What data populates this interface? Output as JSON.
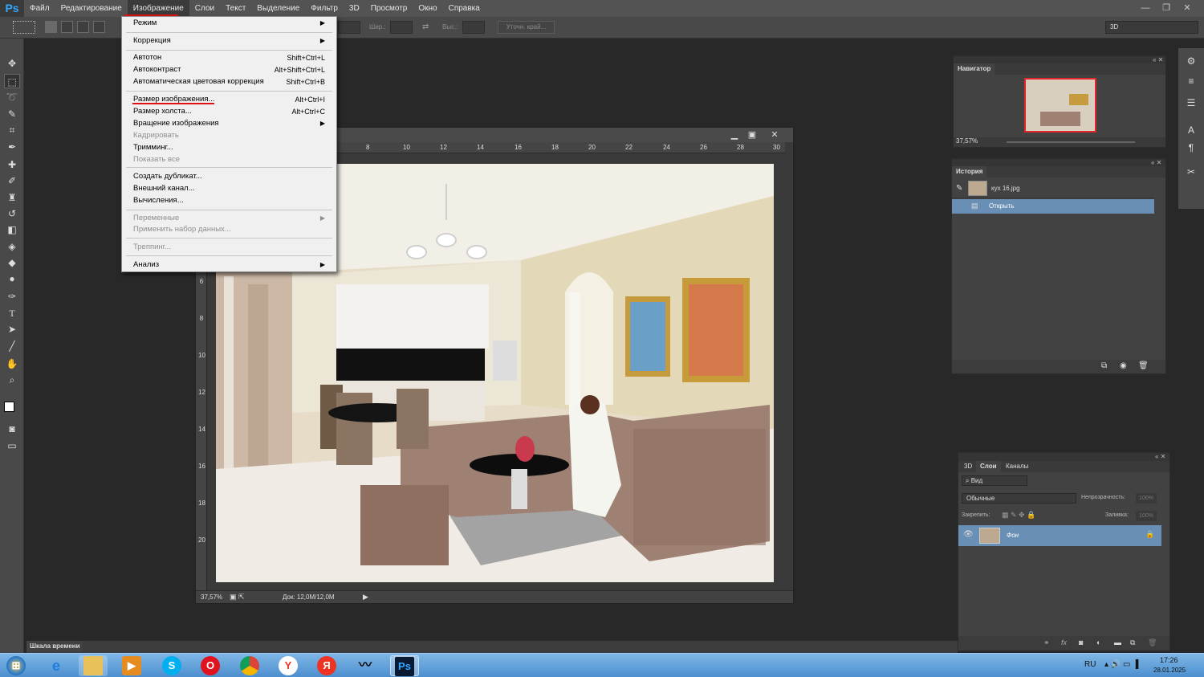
{
  "app": {
    "logo": "Ps"
  },
  "menubar": {
    "items": [
      "Файл",
      "Редактирование",
      "Изображение",
      "Слои",
      "Текст",
      "Выделение",
      "Фильтр",
      "3D",
      "Просмотр",
      "Окно",
      "Справка"
    ],
    "active_index": 2
  },
  "window_controls": {
    "minimize": "—",
    "restore": "❐",
    "close": "✕"
  },
  "options_bar": {
    "width_label": "Шир.:",
    "height_label": "Выс.:",
    "refine_edge_label": "Уточн. край...",
    "workspace": "3D"
  },
  "image_menu": {
    "items": [
      {
        "label": "Режим",
        "shortcut": "",
        "submenu": true,
        "disabled": false
      },
      {
        "label": "Коррекция",
        "shortcut": "",
        "submenu": true,
        "disabled": false
      },
      {
        "label": "Автотон",
        "shortcut": "Shift+Ctrl+L",
        "submenu": false,
        "disabled": false
      },
      {
        "label": "Автоконтраст",
        "shortcut": "Alt+Shift+Ctrl+L",
        "submenu": false,
        "disabled": false
      },
      {
        "label": "Автоматическая цветовая коррекция",
        "shortcut": "Shift+Ctrl+B",
        "submenu": false,
        "disabled": false
      },
      {
        "label": "Размер изображения...",
        "shortcut": "Alt+Ctrl+I",
        "submenu": false,
        "disabled": false,
        "highlighted": true
      },
      {
        "label": "Размер холста...",
        "shortcut": "Alt+Ctrl+C",
        "submenu": false,
        "disabled": false
      },
      {
        "label": "Вращение изображения",
        "shortcut": "",
        "submenu": true,
        "disabled": false
      },
      {
        "label": "Кадрировать",
        "shortcut": "",
        "submenu": false,
        "disabled": true
      },
      {
        "label": "Тримминг...",
        "shortcut": "",
        "submenu": false,
        "disabled": false
      },
      {
        "label": "Показать все",
        "shortcut": "",
        "submenu": false,
        "disabled": true
      },
      {
        "label": "Создать дубликат...",
        "shortcut": "",
        "submenu": false,
        "disabled": false
      },
      {
        "label": "Внешний канал...",
        "shortcut": "",
        "submenu": false,
        "disabled": false
      },
      {
        "label": "Вычисления...",
        "shortcut": "",
        "submenu": false,
        "disabled": false
      },
      {
        "label": "Переменные",
        "shortcut": "",
        "submenu": true,
        "disabled": true
      },
      {
        "label": "Применить набор данных...",
        "shortcut": "",
        "submenu": false,
        "disabled": true
      },
      {
        "label": "Треппинг...",
        "shortcut": "",
        "submenu": false,
        "disabled": true
      },
      {
        "label": "Анализ",
        "shortcut": "",
        "submenu": true,
        "disabled": false
      }
    ]
  },
  "document": {
    "ruler_h": [
      "8",
      "10",
      "12",
      "14",
      "16",
      "18",
      "20",
      "22",
      "24",
      "26",
      "28",
      "30"
    ],
    "ruler_v": [
      "6",
      "8",
      "10",
      "12",
      "14",
      "16",
      "18",
      "20"
    ],
    "zoom": "37,57%",
    "doc_size": "Док: 12,0M/12,0M"
  },
  "navigator": {
    "title": "Навигатор",
    "zoom": "37,57%"
  },
  "history": {
    "title": "История",
    "snapshot": "кух 16.jpg",
    "step": "Открыть"
  },
  "layers": {
    "tabs": [
      "3D",
      "Слои",
      "Каналы"
    ],
    "active_tab": 1,
    "filter": "Вид",
    "blend_mode": "Обычные",
    "opacity_label": "Непрозрачность:",
    "opacity": "100%",
    "lock_label": "Закрепить:",
    "fill_label": "Заливка:",
    "fill": "100%",
    "layer_name": "Фон"
  },
  "timeline": {
    "label": "Шкала времени"
  },
  "taskbar": {
    "lang": "RU",
    "time": "17:26",
    "date": "28.01.2025"
  },
  "colors": {
    "ui_bg": "#282828",
    "panel": "#424242",
    "menubar": "#535353",
    "selection": "#6a8fb5",
    "ps_blue": "#31a8ff",
    "annotation_red": "#dd1111"
  }
}
